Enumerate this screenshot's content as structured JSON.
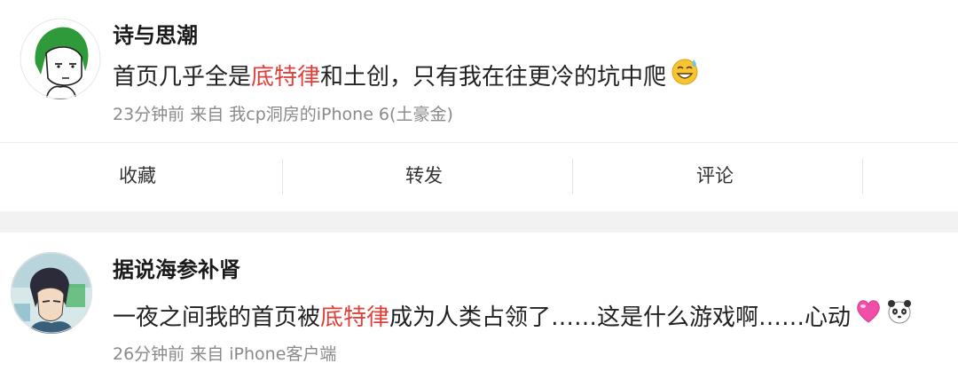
{
  "posts": [
    {
      "username": "诗与思潮",
      "content_before": "首页几乎全是",
      "content_highlight": "底特律",
      "content_after": "和土创，只有我在往更冷的坑中爬",
      "emoji": "grinning-sweat-emoji",
      "meta": "23分钟前  来自  我cp洞房的iPhone 6(土豪金)"
    },
    {
      "username": "据说海参补肾",
      "content_before": "一夜之间我的首页被",
      "content_highlight": "底特律",
      "content_after": "成为人类占领了……这是什么游戏啊……心动",
      "emoji": "pink-heart-emoji",
      "emoji2": "panda-face-emoji",
      "meta": "26分钟前  来自  iPhone客户端"
    }
  ],
  "actions": {
    "collect": "收藏",
    "repost": "转发",
    "comment": "评论"
  },
  "colors": {
    "highlight": "#e0403a",
    "meta": "#8a8a8a",
    "separator": "#f2f2f2"
  }
}
